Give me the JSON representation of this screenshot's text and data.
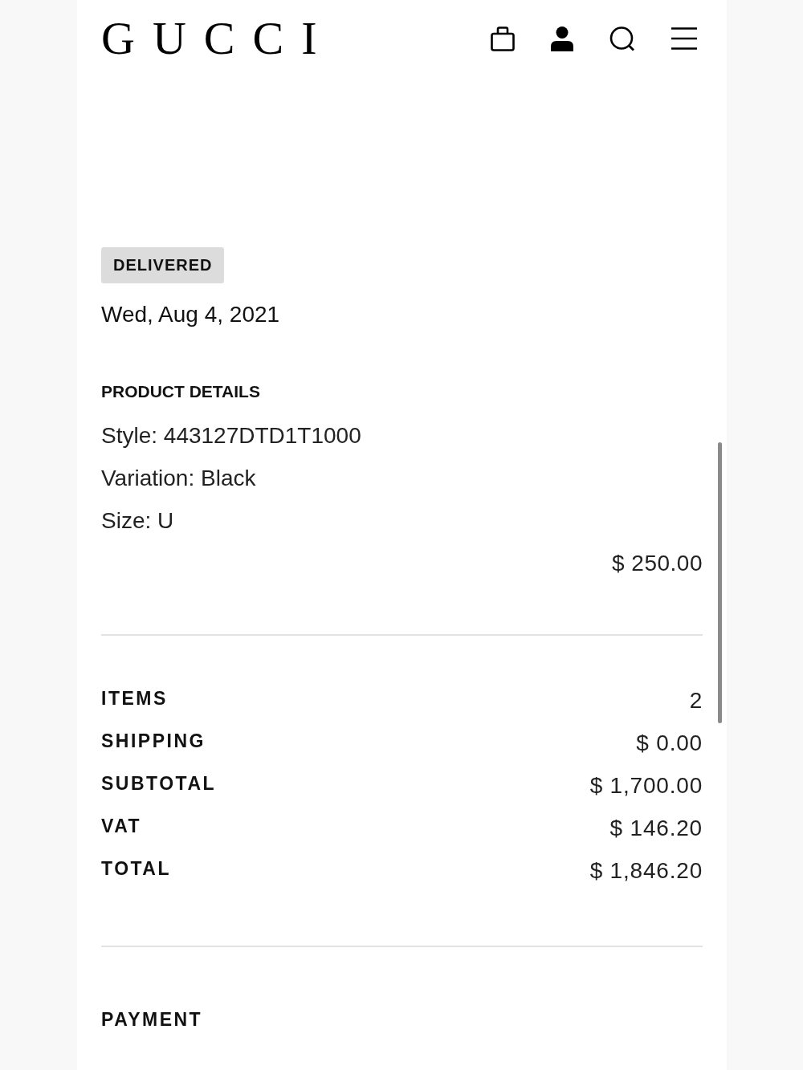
{
  "header": {
    "logo": "GUCCI"
  },
  "order": {
    "status": "DELIVERED",
    "date": "Wed, Aug 4, 2021"
  },
  "product_details": {
    "heading": "PRODUCT DETAILS",
    "lines": [
      "Style: 443127DTD1T1000",
      "Variation: Black",
      "Size: U"
    ],
    "price": "$ 250.00"
  },
  "summary": [
    {
      "label": "ITEMS",
      "value": "2"
    },
    {
      "label": "SHIPPING",
      "value": "$ 0.00"
    },
    {
      "label": "SUBTOTAL",
      "value": "$ 1,700.00"
    },
    {
      "label": "VAT",
      "value": "$ 146.20"
    },
    {
      "label": "TOTAL",
      "value": "$ 1,846.20"
    }
  ],
  "payment": {
    "heading": "PAYMENT"
  }
}
